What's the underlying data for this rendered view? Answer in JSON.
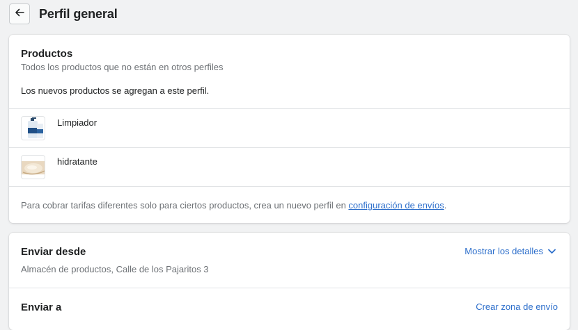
{
  "header": {
    "title": "Perfil general"
  },
  "products_card": {
    "title": "Productos",
    "subtitle": "Todos los productos que no están en otros perfiles",
    "note": "Los nuevos productos se agregan a este perfil.",
    "items": [
      {
        "name": "Limpiador"
      },
      {
        "name": "hidratante"
      }
    ],
    "footer_text": "Para cobrar tarifas diferentes solo para ciertos productos, crea un nuevo perfil en ",
    "footer_link": "configuración de envíos",
    "footer_end": "."
  },
  "shipping_card": {
    "from_title": "Enviar desde",
    "from_action": "Mostrar los detalles",
    "from_location": "Almacén de productos, Calle de los Pajaritos 3",
    "to_title": "Enviar a",
    "to_action": "Crear zona de envío"
  },
  "colors": {
    "accent": "#2c6ecb",
    "background": "#f1f2f3"
  }
}
